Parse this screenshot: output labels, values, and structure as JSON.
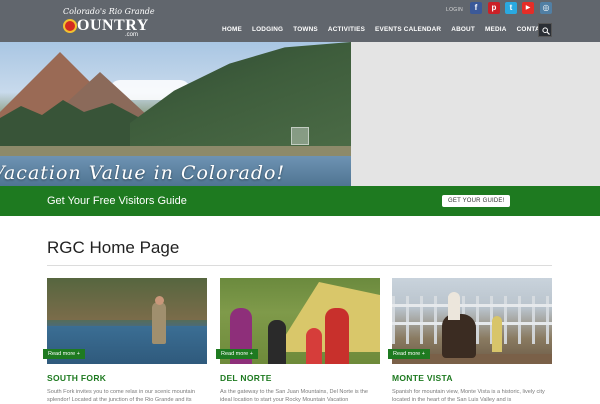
{
  "header": {
    "logo": {
      "script": "Colorado's Rio Grande",
      "word": "OUNTRY",
      "suffix": ".com"
    },
    "login_label": "LOGIN",
    "social": [
      {
        "icon": "facebook-icon",
        "glyph": "f",
        "color": "#3b5998"
      },
      {
        "icon": "pinterest-icon",
        "glyph": "p",
        "color": "#cb2027"
      },
      {
        "icon": "twitter-icon",
        "glyph": "t",
        "color": "#2aa9e0"
      },
      {
        "icon": "youtube-icon",
        "glyph": "▶",
        "color": "#e52d27"
      },
      {
        "icon": "instagram-icon",
        "glyph": "◎",
        "color": "#517fa4"
      }
    ],
    "nav": [
      "HOME",
      "LODGING",
      "TOWNS",
      "ACTIVITIES",
      "EVENTS CALENDAR",
      "ABOUT",
      "MEDIA",
      "CONTACT"
    ],
    "search_icon": "search-icon"
  },
  "hero": {
    "slogan": "Vacation Value in Colorado!"
  },
  "guide": {
    "text": "Get Your Free Visitors Guide",
    "button": "GET YOUR GUIDE!"
  },
  "main": {
    "title": "RGC Home Page",
    "cards": [
      {
        "title": "SOUTH FORK",
        "read_more": "Read more +",
        "description": "South Fork invites you to come relax in our scenic mountain splendor! Located at the junction of the Rio Grande and its"
      },
      {
        "title": "DEL NORTE",
        "read_more": "Read more +",
        "description": "As the gateway to the San Juan Mountains, Del Norte is the ideal location to start your Rocky Mountain Vacation"
      },
      {
        "title": "MONTE VISTA",
        "read_more": "Read more +",
        "description": "Spanish for mountain view, Monte Vista is a historic, lively city located in the heart of the San Luis Valley and is"
      }
    ]
  },
  "colors": {
    "brand_green": "#1e7a20",
    "header_bg": "#3c424c"
  }
}
